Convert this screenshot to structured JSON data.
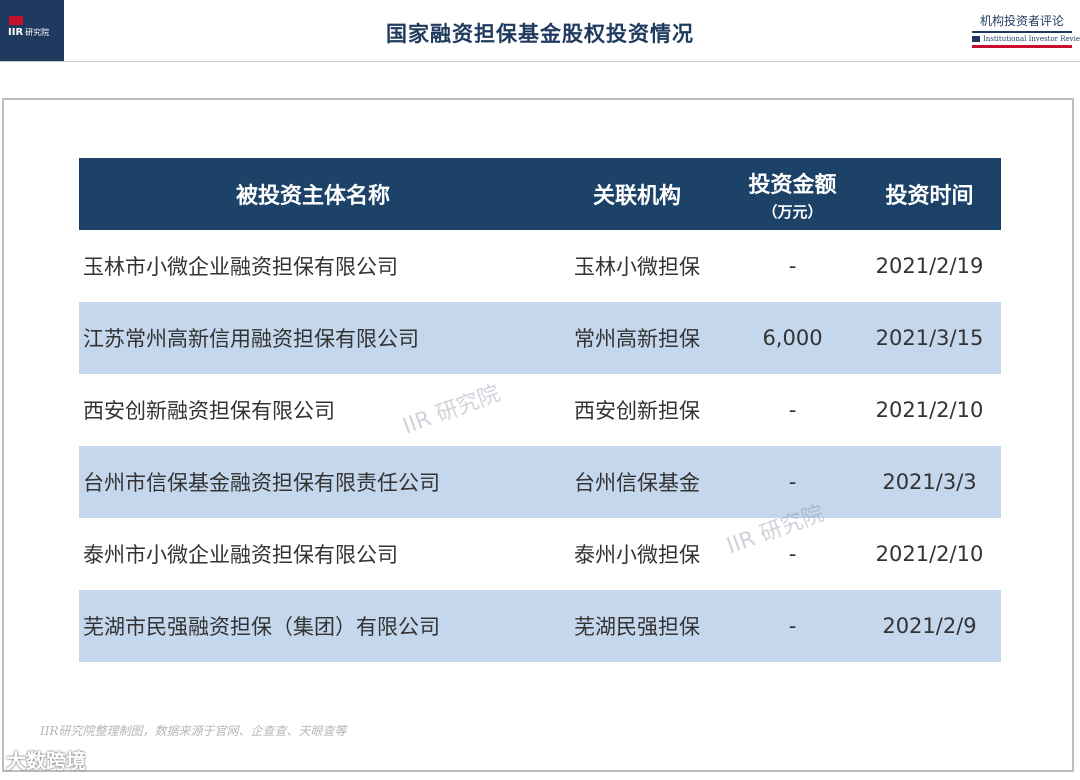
{
  "header": {
    "logo_text": "IIR",
    "logo_sub": "研究院",
    "title": "国家融资担保基金股权投资情况",
    "brand_cn": "机构投资者评论",
    "brand_en": "Institutional Investor Review"
  },
  "table": {
    "columns": [
      {
        "label": "被投资主体名称",
        "sub": ""
      },
      {
        "label": "关联机构",
        "sub": ""
      },
      {
        "label": "投资金额",
        "sub": "（万元）"
      },
      {
        "label": "投资时间",
        "sub": ""
      }
    ],
    "rows": [
      {
        "name": "玉林市小微企业融资担保有限公司",
        "org": "玉林小微担保",
        "amount": "-",
        "date": "2021/2/19"
      },
      {
        "name": "江苏常州高新信用融资担保有限公司",
        "org": "常州高新担保",
        "amount": "6,000",
        "date": "2021/3/15"
      },
      {
        "name": "西安创新融资担保有限公司",
        "org": "西安创新担保",
        "amount": "-",
        "date": "2021/2/10"
      },
      {
        "name": "台州市信保基金融资担保有限责任公司",
        "org": "台州信保基金",
        "amount": "-",
        "date": "2021/3/3"
      },
      {
        "name": "泰州市小微企业融资担保有限公司",
        "org": "泰州小微担保",
        "amount": "-",
        "date": "2021/2/10"
      },
      {
        "name": "芜湖市民强融资担保（集团）有限公司",
        "org": "芜湖民强担保",
        "amount": "-",
        "date": "2021/2/9"
      }
    ]
  },
  "watermarks": [
    "IIR 研究院",
    "IIR 研究院"
  ],
  "source_note": "IIR研究院整理制图，数据来源于官网、企查查、天眼查等",
  "bottom_brand": "大数跨境",
  "colors": {
    "navy": "#1c4268",
    "band": "#c5d7ec",
    "accent": "#c8102e"
  }
}
